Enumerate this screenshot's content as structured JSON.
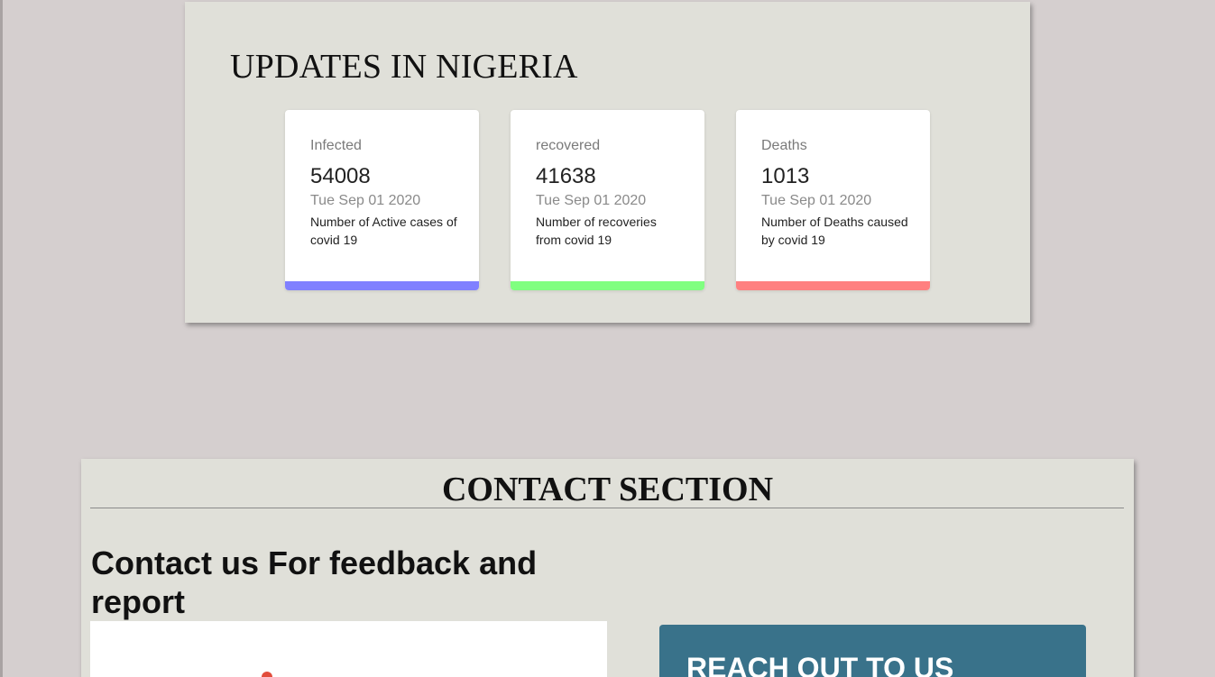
{
  "updates": {
    "title": "UPDATES IN NIGERIA",
    "cards": [
      {
        "label": "Infected",
        "value": "54008",
        "date": "Tue Sep 01 2020",
        "description": "Number of Active cases of covid 19",
        "bar_color": "#8080ff"
      },
      {
        "label": "recovered",
        "value": "41638",
        "date": "Tue Sep 01 2020",
        "description": "Number of recoveries from covid 19",
        "bar_color": "#80ff80"
      },
      {
        "label": "Deaths",
        "value": "1013",
        "date": "Tue Sep 01 2020",
        "description": "Number of Deaths caused by covid 19",
        "bar_color": "#ff8080"
      }
    ]
  },
  "contact": {
    "title": "CONTACT SECTION",
    "heading": "Contact us For feedback and report",
    "reach_title": "REACH OUT TO US"
  },
  "colors": {
    "page_background": "#d5cfcf",
    "panel_background": "#e0e0d9",
    "reach_box": "#39728a",
    "map_pin": "#e24d3c"
  },
  "icons": {
    "map_pin": "map-pin-icon"
  }
}
